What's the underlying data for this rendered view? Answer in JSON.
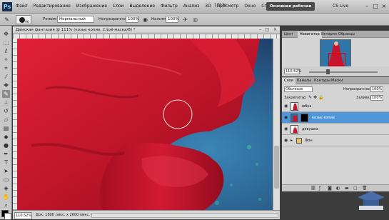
{
  "menubar": {
    "logo": "Ps",
    "items": [
      "Файл",
      "Редактирование",
      "Изображение",
      "Слои",
      "Выделение",
      "Фильтр",
      "Анализ",
      "3D",
      "Просмотр",
      "Окно",
      "Справка"
    ],
    "zoom": "111%",
    "workspace_button": "Основная рабочая среда",
    "cs_live": "CS Live"
  },
  "options": {
    "mode_label": "Режим:",
    "mode_value": "Нормальный",
    "opacity_label": "Непрозрачность:",
    "opacity_value": "100%",
    "pressure_label": "Нажим:",
    "pressure_value": "100%",
    "brush_size": "90"
  },
  "document": {
    "tab_title": "Дамская фантазия @ 111% (козье копие, Слой-маска/8) *",
    "zoom": "110.52%",
    "info": "Док: 1800 пикс. x 2600 пикс. (72 ppi)"
  },
  "navigator": {
    "tabs": [
      "Цвет",
      "Навигатор",
      "История",
      "Образцы"
    ],
    "active_tab": "Навигатор",
    "zoom": "110.52%"
  },
  "layers": {
    "tabs": [
      "Слои",
      "Каналы",
      "Контуры",
      "Маски"
    ],
    "blend_mode": "Обычные",
    "opacity_label": "Непрозрачность:",
    "opacity_value": "100%",
    "lock_label": "Закрепить:",
    "fill_label": "Заливка:",
    "fill_value": "100%",
    "rows": [
      {
        "name": "юбка"
      },
      {
        "name": "козье копие"
      },
      {
        "name": "девушка"
      },
      {
        "name": "Фон"
      }
    ]
  },
  "colors": {
    "accent_selected": "#4e95d9",
    "dress_red": "#c0152a",
    "background_blue": "#2d6d9e"
  }
}
